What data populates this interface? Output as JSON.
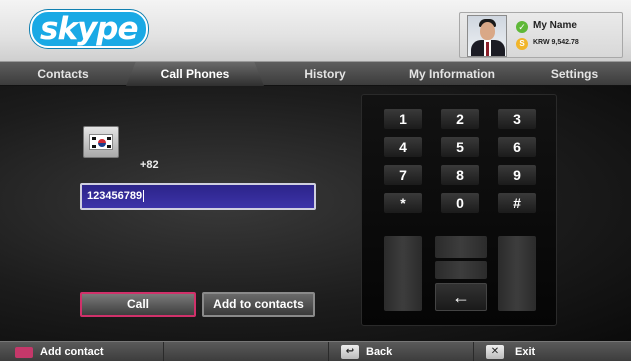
{
  "header": {
    "logo_text": "skype",
    "profile": {
      "name": "My Name",
      "credit": "KRW 9,542.78",
      "status_icon": "check-icon",
      "credit_icon": "skype-credit-icon",
      "status_color": "#5fb838"
    }
  },
  "tabs": [
    {
      "label": "Contacts",
      "active": false
    },
    {
      "label": "Call Phones",
      "active": true
    },
    {
      "label": "History",
      "active": false
    },
    {
      "label": "My Information",
      "active": false
    },
    {
      "label": "Settings",
      "active": false
    }
  ],
  "dialer": {
    "country_flag": "south-korea-flag-icon",
    "country_code": "+82",
    "phone_number": "123456789",
    "call_label": "Call",
    "add_contact_label": "Add to contacts",
    "call_highlight_color": "#d0316a",
    "input_color": "#2c248a"
  },
  "keypad": {
    "keys": [
      "1",
      "2",
      "3",
      "4",
      "5",
      "6",
      "7",
      "8",
      "9",
      "*",
      "0",
      "#"
    ],
    "backspace_symbol": "←"
  },
  "footer": {
    "add_contact": "Add contact",
    "back": "Back",
    "back_icon": "↩",
    "exit": "Exit",
    "exit_icon": "✕"
  }
}
